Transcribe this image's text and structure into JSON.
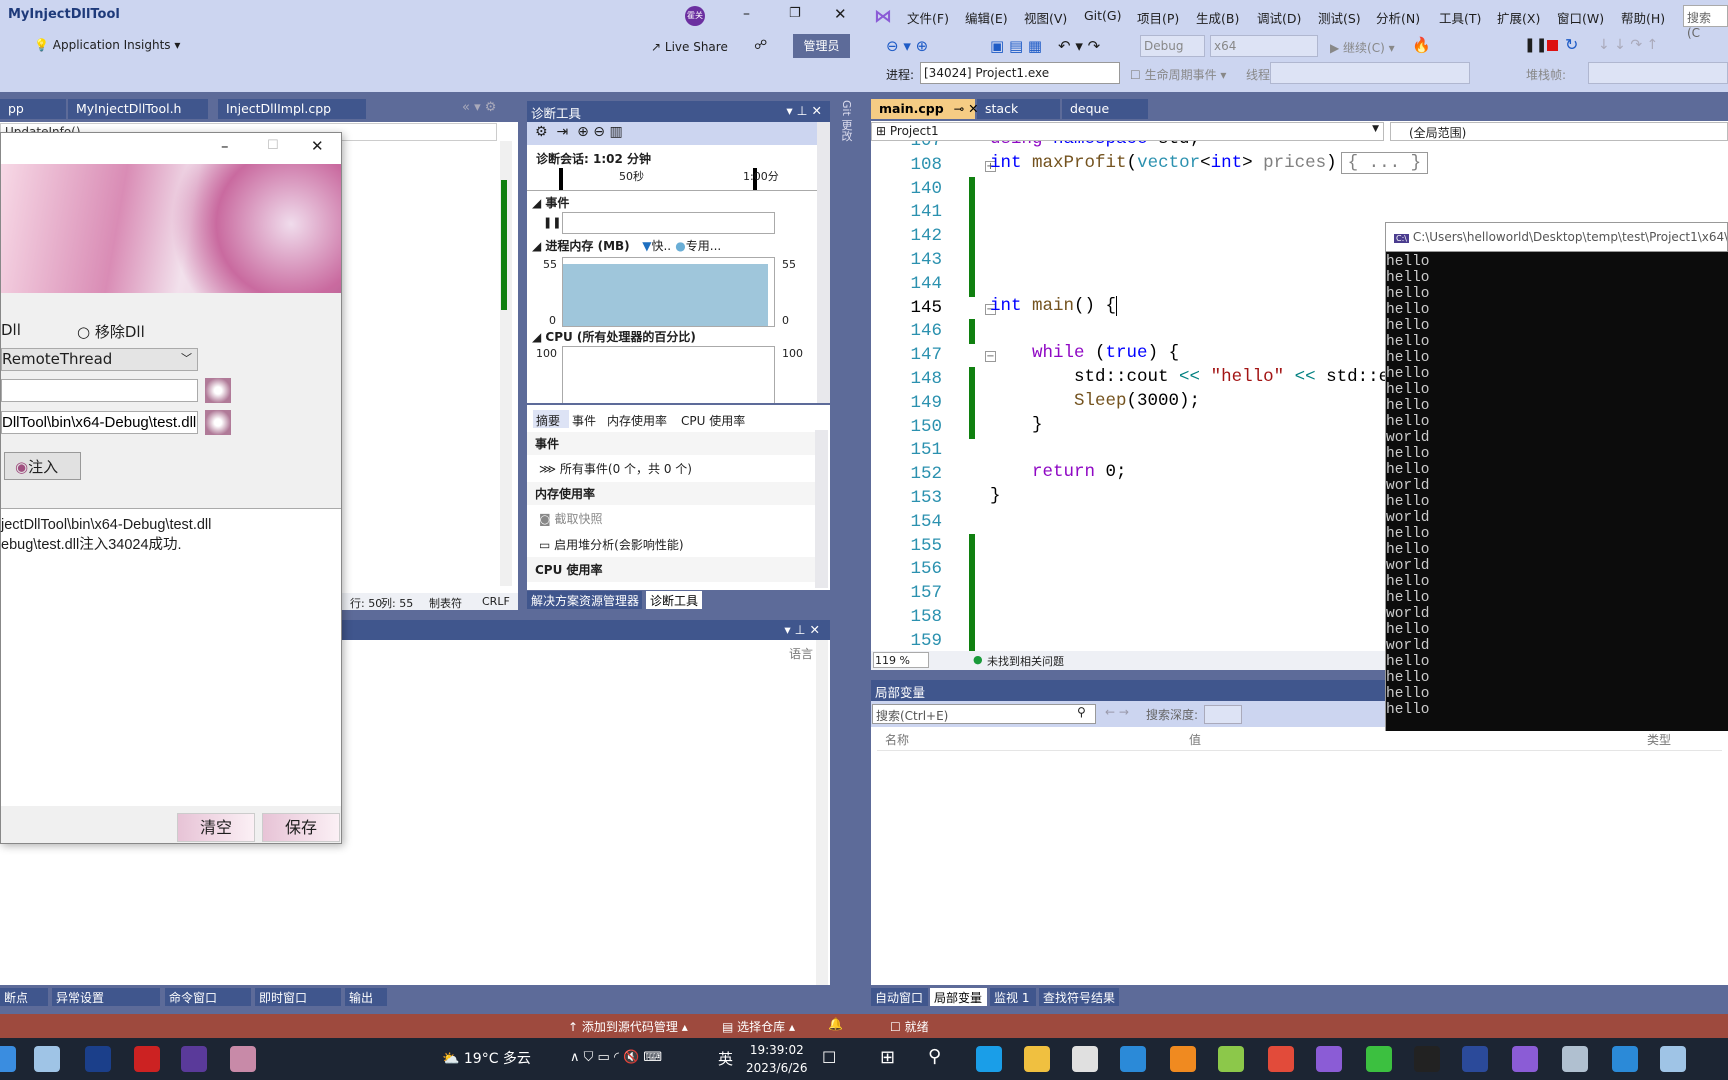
{
  "left_window": {
    "title": "MyInjectDllTool",
    "app_insights": "Application Insights",
    "live_share": "Live Share",
    "admin_badge": "管理员",
    "avatar_text": "霍关"
  },
  "menu": [
    "文件(F)",
    "编辑(E)",
    "视图(V)",
    "Git(G)",
    "项目(P)",
    "生成(B)",
    "调试(D)",
    "测试(S)",
    "分析(N)",
    "工具(T)",
    "扩展(X)",
    "窗口(W)",
    "帮助(H)"
  ],
  "search_placeholder": "搜索 (C",
  "toolbar": {
    "config": "Debug",
    "platform": "x64",
    "continue": "继续(C)",
    "process_label": "进程:",
    "process_value": "[34024] Project1.exe",
    "lifecycle": "生命周期事件",
    "thread_label": "线程:",
    "stack_label": "堆栈帧:"
  },
  "left_tabs": [
    "pp",
    "MyInjectDllTool.h",
    "InjectDllImpl.cpp"
  ],
  "left_nav": "UpdateInfo()",
  "left_status": {
    "line": "行: 50",
    "col": "列: 55",
    "tab": "制表符",
    "eol": "CRLF"
  },
  "dialog": {
    "radio_inject": "Dll",
    "radio_remove": "移除Dll",
    "method": "RemoteThread",
    "process_input": "",
    "dll_path": "DllTool\\bin\\x64-Debug\\test.dll",
    "inject_button": "注入",
    "log": [
      "jectDllTool\\bin\\x64-Debug\\test.dll",
      "ebug\\test.dll注入34024成功."
    ],
    "clear_button": "清空",
    "save_button": "保存"
  },
  "diag": {
    "title": "诊断工具",
    "session": "诊断会话: 1:02 分钟",
    "tick_50": "50秒",
    "tick_100": "1:00分",
    "events": "事件",
    "memory": "进程内存 (MB)",
    "legend_snapshot": "快..",
    "legend_private": "专用...",
    "mem_max": "55",
    "mem_min": "0",
    "mem_value_mb": 50,
    "cpu": "CPU (所有处理器的百分比)",
    "cpu_max": "100",
    "tabs": [
      "摘要",
      "事件",
      "内存使用率",
      "CPU 使用率"
    ],
    "sections": {
      "events": "事件",
      "all_events": "所有事件(0 个，共 0 个)",
      "memory": "内存使用率",
      "snapshot": "截取快照",
      "heap": "启用堆分析(会影响性能)",
      "cpu": "CPU 使用率"
    },
    "bottom_tabs": [
      "解决方案资源管理器",
      "诊断工具"
    ]
  },
  "git_changes": "Git 更改",
  "output_pane": {
    "lang_header": "语言"
  },
  "left_bottom_tabs": [
    "断点",
    "异常设置",
    "命令窗口",
    "即时窗口",
    "输出"
  ],
  "editor": {
    "tabs": [
      "main.cpp",
      "stack",
      "deque"
    ],
    "project": "Project1",
    "scope": "(全局范围)",
    "zoom": "119 %",
    "issues": "未找到相关问题",
    "lines": [
      {
        "n": "107",
        "t": [
          [
            "ctl",
            "using"
          ],
          [
            "tx",
            " "
          ],
          [
            "kw",
            "namespace"
          ],
          [
            "tx",
            " std;"
          ]
        ]
      },
      {
        "n": "108",
        "fold": "+",
        "t": [
          [
            "kw",
            "int"
          ],
          [
            "tx",
            " "
          ],
          [
            "fn",
            "maxProfit"
          ],
          [
            "tx",
            "("
          ],
          [
            "ty",
            "vector"
          ],
          [
            "tx",
            "<"
          ],
          [
            "kw",
            "int"
          ],
          [
            "tx",
            "> "
          ],
          [
            "par",
            "prices"
          ],
          [
            "tx",
            ")"
          ]
        ],
        "collapsed": "{ ... }"
      },
      {
        "n": "140",
        "g": 1,
        "t": []
      },
      {
        "n": "141",
        "g": 1,
        "t": []
      },
      {
        "n": "142",
        "g": 1,
        "t": []
      },
      {
        "n": "143",
        "g": 1,
        "t": []
      },
      {
        "n": "144",
        "g": 1,
        "t": []
      },
      {
        "n": "145",
        "fold": "-",
        "cur": 1,
        "t": [
          [
            "kw",
            "int"
          ],
          [
            "tx",
            " "
          ],
          [
            "fn",
            "main"
          ],
          [
            "tx",
            "() {"
          ]
        ]
      },
      {
        "n": "146",
        "g": 1,
        "t": []
      },
      {
        "n": "147",
        "fold": "-",
        "t": [
          [
            "tx",
            "    "
          ],
          [
            "ctl",
            "while"
          ],
          [
            "tx",
            " ("
          ],
          [
            "kw",
            "true"
          ],
          [
            "tx",
            ") {"
          ]
        ]
      },
      {
        "n": "148",
        "g": 1,
        "t": [
          [
            "tx",
            "        std::cout "
          ],
          [
            "op",
            "<<"
          ],
          [
            "tx",
            " "
          ],
          [
            "str",
            "\"hello\""
          ],
          [
            "tx",
            " "
          ],
          [
            "op",
            "<<"
          ],
          [
            "tx",
            " std::e"
          ]
        ]
      },
      {
        "n": "149",
        "g": 1,
        "t": [
          [
            "tx",
            "        "
          ],
          [
            "fn",
            "Sleep"
          ],
          [
            "tx",
            "(3000);"
          ]
        ]
      },
      {
        "n": "150",
        "g": 1,
        "t": [
          [
            "tx",
            "    }"
          ]
        ]
      },
      {
        "n": "151",
        "t": []
      },
      {
        "n": "152",
        "t": [
          [
            "tx",
            "    "
          ],
          [
            "ctl",
            "return"
          ],
          [
            "tx",
            " 0;"
          ]
        ]
      },
      {
        "n": "153",
        "t": [
          [
            "tx",
            "}"
          ]
        ]
      },
      {
        "n": "154",
        "t": []
      },
      {
        "n": "155",
        "g": 1,
        "t": []
      },
      {
        "n": "156",
        "g": 1,
        "t": []
      },
      {
        "n": "157",
        "g": 1,
        "t": []
      },
      {
        "n": "158",
        "g": 1,
        "t": []
      },
      {
        "n": "159",
        "g": 1,
        "t": []
      }
    ]
  },
  "console": {
    "title": "C:\\Users\\helloworld\\Desktop\\temp\\test\\Project1\\x64\\",
    "lines": [
      "hello",
      "hello",
      "hello",
      "hello",
      "hello",
      "hello",
      "hello",
      "hello",
      "hello",
      "hello",
      "hello",
      "world",
      "hello",
      "hello",
      "world",
      "hello",
      "world",
      "hello",
      "hello",
      "world",
      "hello",
      "hello",
      "world",
      "hello",
      "world",
      "hello",
      "hello",
      "hello",
      "hello"
    ]
  },
  "locals": {
    "title": "局部变量",
    "search_placeholder": "搜索(Ctrl+E)",
    "depth_label": "搜索深度:",
    "col_name": "名称",
    "col_value": "值",
    "col_type": "类型"
  },
  "right_bottom_tabs": [
    "自动窗口",
    "局部变量",
    "监视 1",
    "查找符号结果"
  ],
  "status": {
    "add_source": "添加到源代码管理",
    "select_repo": "选择仓库",
    "ready": "就绪"
  },
  "taskbar": {
    "weather": "19°C  多云",
    "ime": "英",
    "time": "19:39:02",
    "date": "2023/6/26"
  },
  "colors": {
    "accent": "#40568d",
    "chrome": "#ccd5f0",
    "status": "#9e4a3e",
    "active_tab": "#f5cc84",
    "change_bar": "#108010"
  }
}
